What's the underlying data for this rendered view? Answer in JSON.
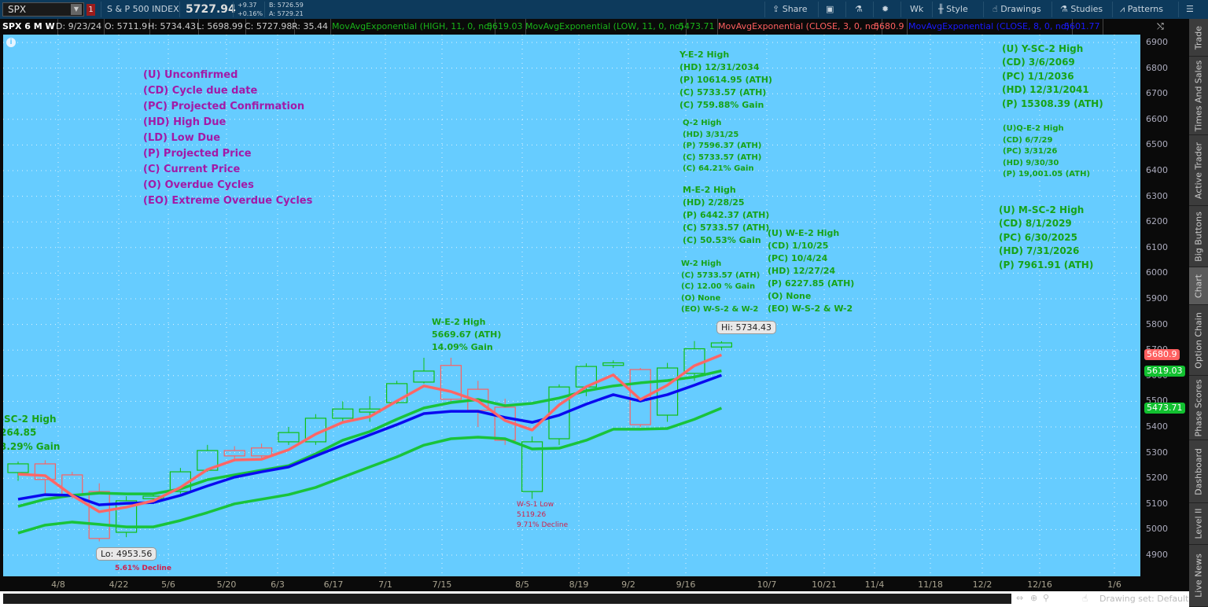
{
  "toolbar": {
    "symbol": "SPX",
    "alert_count": "1",
    "name": "S & P 500 INDEX",
    "last": "5727.94",
    "change": "+9.37",
    "change_pct": "+0.16%",
    "bid": "B: 5726.59",
    "ask": "A: 5729.21",
    "buttons": {
      "share": "Share",
      "aggregation": "Wk",
      "style": "Style",
      "drawings": "Drawings",
      "studies": "Studies",
      "patterns": "Patterns"
    }
  },
  "infobar": {
    "label": "SPX 6 M W",
    "date": "D: 9/23/24",
    "open": "O: 5711.9",
    "high": "H: 5734.43",
    "low": "L: 5698.99",
    "close": "C: 5727.98",
    "range": "R: 35.44",
    "studies": [
      {
        "name": "MovAvgExponential (HIGH, 11, 0, no)",
        "value": "5619.03",
        "color": "#19b319"
      },
      {
        "name": "MovAvgExponential (LOW, 11, 0, no)",
        "value": "5473.71",
        "color": "#19b319"
      },
      {
        "name": "MovAvgExponential (CLOSE, 3, 0, no)",
        "value": "5680.9",
        "color": "#ff5f5f"
      },
      {
        "name": "MovAvgExponential (CLOSE, 8, 0, no)",
        "value": "5601.77",
        "color": "#1a1aff"
      }
    ]
  },
  "legend": [
    "(U) Unconfirmed",
    "(CD) Cycle due date",
    "(PC) Projected Confirmation",
    "(HD) High Due",
    "(LD) Low Due",
    "(P) Projected Price",
    "(C) Current Price",
    "(O) Overdue Cycles",
    "(EO) Extreme Overdue Cycles"
  ],
  "annotations": {
    "ye2": [
      "Y-E-2 High",
      "(HD) 12/31/2034",
      "(P) 10614.95 (ATH)",
      "(C) 5733.57 (ATH)",
      "(C) 759.88% Gain"
    ],
    "q2": [
      "Q-2 High",
      "(HD) 3/31/25",
      "(P) 7596.37 (ATH)",
      "(C) 5733.57 (ATH)",
      "(C) 64.21% Gain"
    ],
    "me2": [
      "M-E-2 High",
      "(HD) 2/28/25",
      "(P) 6442.37 (ATH)",
      "(C) 5733.57 (ATH)",
      "(C) 50.53% Gain"
    ],
    "w2": [
      "W-2 High",
      "(C) 5733.57 (ATH)",
      "(C) 12.00 % Gain",
      "(O) None",
      "(EO) W-S-2 & W-2"
    ],
    "we2u": [
      "(U) W-E-2 High",
      "(CD) 1/10/25",
      "(PC) 10/4/24",
      "(HD) 12/27/24",
      "(P) 6227.85 (ATH)",
      "(O) None",
      "(EO) W-S-2 & W-2"
    ],
    "ysc2": [
      "(U) Y-SC-2 High",
      "(CD) 3/6/2069",
      "(PC) 1/1/2036",
      "(HD) 12/31/2041",
      "(P) 15308.39 (ATH)"
    ],
    "qe2": [
      "(U)Q-E-2 High",
      "(CD) 6/7/29",
      "(PC) 3/31/26",
      "(HD) 9/30/30",
      "(P) 19,001.05 (ATH)"
    ],
    "msc2": [
      "(U) M-SC-2 High",
      "(CD) 8/1/2029",
      "(PC) 6/30/2025",
      "(HD) 7/31/2026",
      "(P) 7961.91 (ATH)"
    ],
    "we2": [
      "W-E-2 High",
      "5669.67 (ATH)",
      "14.09% Gain"
    ],
    "left": [
      "-SC-2 High",
      "264.85",
      "3.29% Gain"
    ],
    "ws1": [
      "W-S-1 Low",
      "5119.26",
      "9.71% Decline"
    ],
    "lo_decline": "5.61% Decline",
    "lo_callout": "Lo: 4953.56",
    "hi_callout": "Hi: 5734.43"
  },
  "chart_data": {
    "type": "candlestick",
    "interval": "weekly",
    "ylim": [
      4850,
      6950
    ],
    "yticks": [
      6900,
      6800,
      6700,
      6600,
      6500,
      6400,
      6300,
      6200,
      6100,
      6000,
      5900,
      5800,
      5700,
      5600,
      5500,
      5400,
      5300,
      5200,
      5100,
      5000,
      4900
    ],
    "xticks": [
      "4/8",
      "4/22",
      "5/6",
      "5/20",
      "6/3",
      "6/17",
      "7/1",
      "7/15",
      "8/5",
      "8/19",
      "9/2",
      "9/16",
      "10/7",
      "10/21",
      "11/4",
      "11/18",
      "12/2",
      "12/16",
      "1/6"
    ],
    "ohlc": [
      [
        5222,
        5265,
        5190,
        5256
      ],
      [
        5256,
        5270,
        5140,
        5195
      ],
      [
        5213,
        5225,
        5120,
        5133
      ],
      [
        5148,
        5180,
        4953.56,
        4965
      ],
      [
        4989,
        5130,
        4970,
        5112
      ],
      [
        5120,
        5140,
        5100,
        5130
      ],
      [
        5148,
        5240,
        5140,
        5225
      ],
      [
        5231,
        5330,
        5225,
        5308
      ],
      [
        5308,
        5325,
        5265,
        5287
      ],
      [
        5318,
        5335,
        5270,
        5287
      ],
      [
        5342,
        5400,
        5330,
        5378
      ],
      [
        5342,
        5450,
        5330,
        5434
      ],
      [
        5434,
        5500,
        5420,
        5470
      ],
      [
        5458,
        5520,
        5420,
        5470
      ],
      [
        5495,
        5580,
        5490,
        5569
      ],
      [
        5575,
        5670,
        5570,
        5618
      ],
      [
        5640,
        5670,
        5494,
        5508
      ],
      [
        5547,
        5580,
        5400,
        5465
      ],
      [
        5477,
        5510,
        5330,
        5348
      ],
      [
        5148,
        5363,
        5119.26,
        5342
      ],
      [
        5354,
        5566,
        5330,
        5556
      ],
      [
        5556,
        5648,
        5520,
        5636
      ],
      [
        5640,
        5660,
        5630,
        5650
      ],
      [
        5624,
        5630,
        5400,
        5409
      ],
      [
        5446,
        5650,
        5420,
        5630
      ],
      [
        5609,
        5735,
        5580,
        5705
      ],
      [
        5711.9,
        5734.43,
        5698.99,
        5727.98
      ]
    ],
    "series": [
      {
        "name": "EMA HIGH 11",
        "color": "#19c33a",
        "last": "5619.03",
        "values": [
          5090,
          5118,
          5133,
          5142,
          5139,
          5139,
          5158,
          5194,
          5213,
          5231,
          5249,
          5295,
          5348,
          5382,
          5430,
          5474,
          5495,
          5507,
          5483,
          5492,
          5513,
          5541,
          5560,
          5572,
          5581,
          5595,
          5619.03
        ]
      },
      {
        "name": "EMA LOW 11",
        "color": "#19c33a",
        "last": "5473.71",
        "values": [
          4986,
          5017,
          5029,
          5020,
          5010,
          5010,
          5035,
          5066,
          5100,
          5118,
          5136,
          5164,
          5204,
          5244,
          5283,
          5329,
          5354,
          5360,
          5354,
          5314,
          5317,
          5348,
          5391,
          5391,
          5394,
          5430,
          5473.71
        ]
      },
      {
        "name": "EMA CLOSE 8",
        "color": "#0a0af0",
        "last": "5601.77",
        "values": [
          5118,
          5136,
          5133,
          5096,
          5102,
          5105,
          5133,
          5170,
          5204,
          5225,
          5244,
          5287,
          5329,
          5369,
          5409,
          5452,
          5461,
          5461,
          5437,
          5418,
          5446,
          5489,
          5526,
          5501,
          5526,
          5563,
          5601.77
        ]
      },
      {
        "name": "EMA CLOSE 3",
        "color": "#ff6666",
        "last": "5680.9",
        "values": [
          5216,
          5210,
          5133,
          5069,
          5087,
          5112,
          5164,
          5234,
          5271,
          5274,
          5311,
          5372,
          5418,
          5440,
          5501,
          5560,
          5538,
          5501,
          5425,
          5388,
          5486,
          5557,
          5603,
          5507,
          5563,
          5639,
          5680.9
        ]
      }
    ]
  },
  "sidebar": [
    "Trade",
    "Times And Sales",
    "Active Trader",
    "Big Buttons",
    "Chart",
    "Option Chain",
    "Phase Scores",
    "Dashboard",
    "Level II",
    "Live News"
  ],
  "footer": {
    "drawing_set": "Drawing set: Default"
  }
}
